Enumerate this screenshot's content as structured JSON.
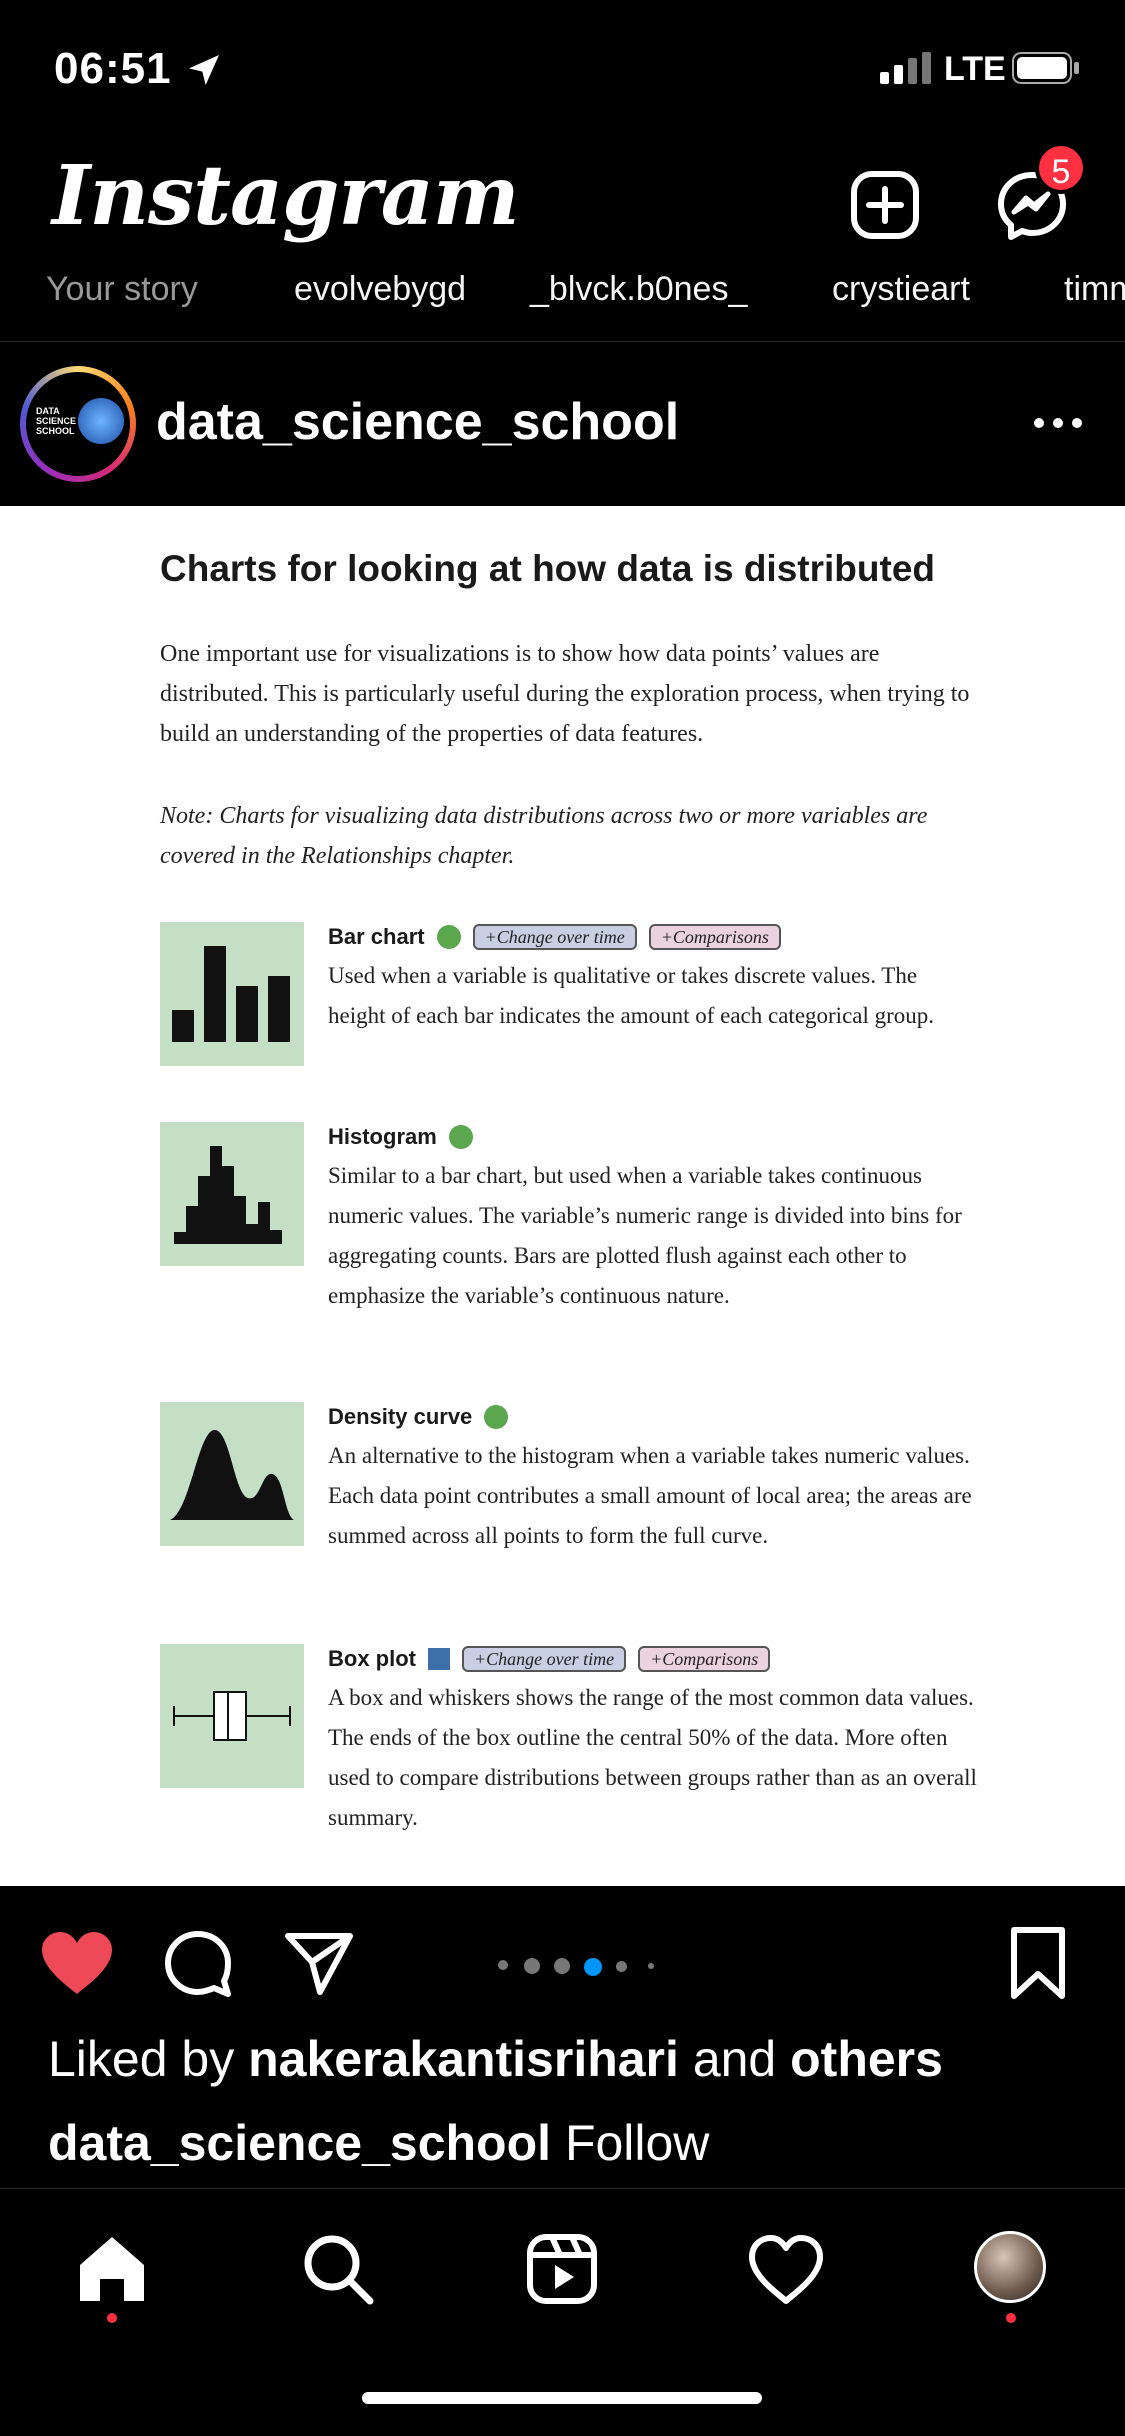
{
  "status_bar": {
    "time": "06:51",
    "network": "LTE",
    "icons": [
      "location-arrow-icon",
      "signal-icon",
      "battery-icon"
    ]
  },
  "header": {
    "logo": "Instagram",
    "icons": [
      "new-post-icon",
      "messenger-icon"
    ],
    "notification_count": "5"
  },
  "stories": [
    {
      "label": "Your story"
    },
    {
      "label": "evolvebygd"
    },
    {
      "label": "_blvck.b0nes_"
    },
    {
      "label": "crystieart"
    },
    {
      "label": "timm"
    }
  ],
  "post": {
    "username": "data_science_school",
    "avatar_text": "DATA SCIENCE SCHOOL",
    "image": {
      "title": "Charts for looking at how data is distributed",
      "intro": "One important use for visualizations is to show how data points’ values are distributed. This is particularly useful during the exploration process, when trying to build an understanding of the properties of data features.",
      "note": "Note: Charts for visualizing data distributions across two or more variables are covered in the Relationships chapter.",
      "items": [
        {
          "name": "Bar chart",
          "marker": "green-dot",
          "tags": [
            "+Change over time",
            "+Comparisons"
          ],
          "description": "Used when a variable is qualitative or takes discrete values. The height of each bar indicates the amount of each categorical group."
        },
        {
          "name": "Histogram",
          "marker": "green-dot",
          "tags": [],
          "description": "Similar to a bar chart, but used when a variable takes continuous numeric values. The variable’s numeric range is divided into bins for aggregating counts. Bars are plotted flush against each other to emphasize the variable’s continuous nature."
        },
        {
          "name": "Density curve",
          "marker": "green-dot",
          "tags": [],
          "description": "An alternative to the histogram when a variable takes numeric values. Each data point contributes a small amount of local area; the areas are summed across all points to form the full curve."
        },
        {
          "name": "Box plot",
          "marker": "blue-square",
          "tags": [
            "+Change over time",
            "+Comparisons"
          ],
          "description": "A box and whiskers shows the range of the most common data values. The ends of the box outline the central 50% of the data. More often used to compare distributions between groups rather than as an overall summary."
        }
      ]
    },
    "liked_by_prefix": "Liked by ",
    "liked_by_user": "nakerakantisrihari",
    "liked_by_and": " and ",
    "liked_by_others": "others",
    "caption_user": "data_science_school",
    "follow_label": "Follow"
  },
  "colors": {
    "like_red": "#ed4956",
    "badge_red": "#ff3040",
    "active_dot_blue": "#0095f6",
    "thumb_green": "#c4dfc6"
  },
  "bottom_nav": [
    "home-icon",
    "search-icon",
    "reels-icon",
    "activity-heart-icon",
    "profile-avatar"
  ]
}
